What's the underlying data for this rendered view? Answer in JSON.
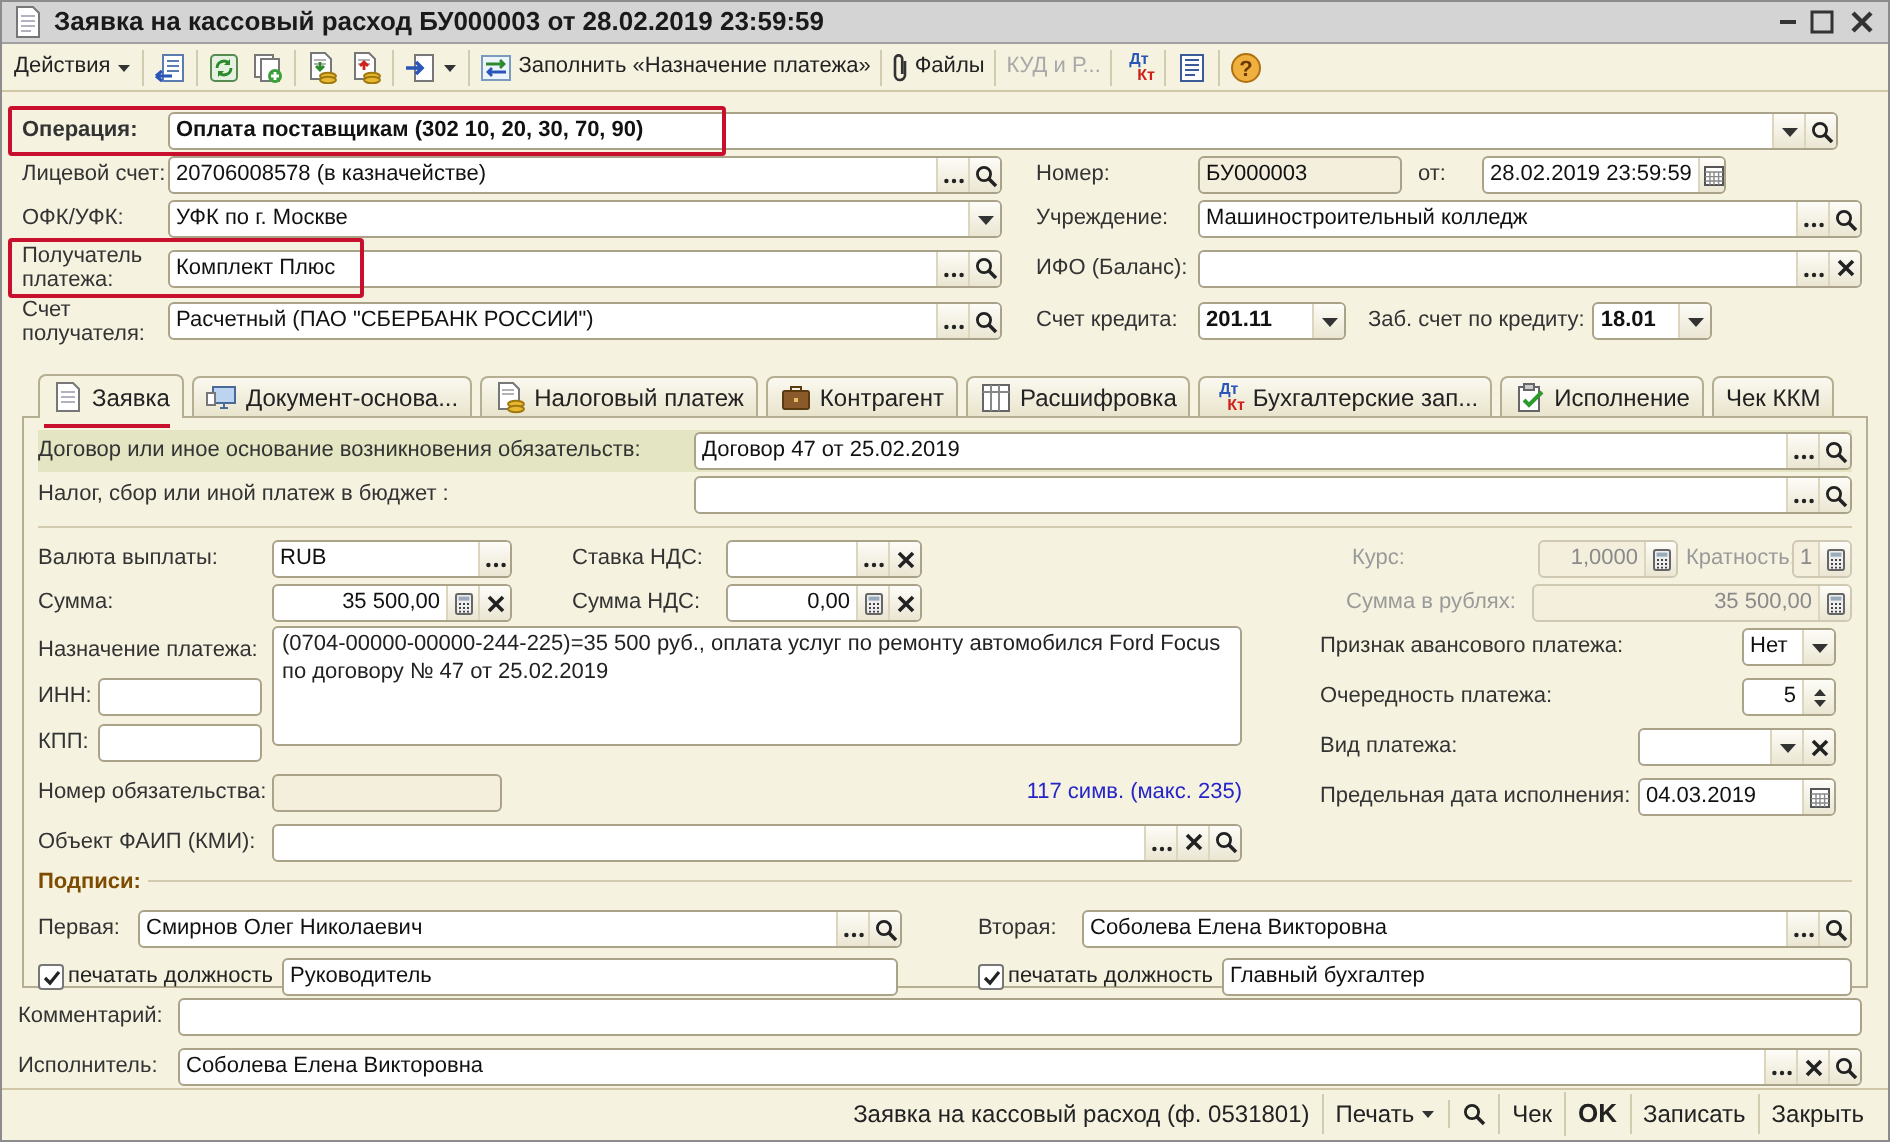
{
  "window": {
    "title": "Заявка на кассовый расход БУ000003 от 28.02.2019 23:59:59"
  },
  "toolbar": [
    {
      "kind": "menu",
      "label": "Действия",
      "disabled": false
    },
    {
      "kind": "separator"
    },
    {
      "kind": "icon",
      "disabled": false
    },
    {
      "kind": "separator"
    },
    {
      "kind": "icon",
      "disabled": false
    },
    {
      "kind": "icon",
      "disabled": false
    },
    {
      "kind": "separator"
    },
    {
      "kind": "icon",
      "disabled": false
    },
    {
      "kind": "icon",
      "disabled": false
    },
    {
      "kind": "separator"
    },
    {
      "kind": "icon_menu",
      "disabled": false
    },
    {
      "kind": "separator"
    },
    {
      "kind": "icon_text",
      "label": "Заполнить «Назначение платежа»",
      "disabled": false
    },
    {
      "kind": "separator"
    },
    {
      "kind": "icon_text",
      "label": "Файлы",
      "disabled": false
    },
    {
      "kind": "separator"
    },
    {
      "kind": "text",
      "label": "КУД и Р...",
      "disabled": true
    },
    {
      "kind": "separator"
    },
    {
      "kind": "debit_credit",
      "debit": "Дт",
      "credit": "Кт",
      "disabled": false
    },
    {
      "kind": "separator"
    },
    {
      "kind": "icon",
      "disabled": false
    },
    {
      "kind": "separator"
    },
    {
      "kind": "help",
      "label": "?",
      "disabled": false
    }
  ],
  "header": {
    "operation": {
      "label": "Операция:",
      "value": "Оплата поставщикам (302 10, 20, 30, 70, 90)",
      "highlighted": true
    },
    "account": {
      "label": "Лицевой счет:",
      "value": "20706008578 (в казначействе)"
    },
    "number": {
      "label": "Номер:",
      "value": "БУ000003",
      "readonly": true
    },
    "date": {
      "label": "от:",
      "value": "28.02.2019 23:59:59"
    },
    "ofk": {
      "label": "ОФК/УФК:",
      "value": "УФК по г. Москве"
    },
    "institution": {
      "label": "Учреждение:",
      "value": "Машиностроительный колледж"
    },
    "recipient": {
      "label": "Получатель платежа:",
      "value": "Комплект Плюс",
      "highlighted": true
    },
    "ifo": {
      "label": "ИФО (Баланс):"
    },
    "recipient_account": {
      "label": "Счет получателя:",
      "value": "Расчетный (ПАО \"СБЕРБАНК РОССИИ\")"
    },
    "credit_account": {
      "label": "Счет кредита:",
      "value": "201.11"
    },
    "off_balance": {
      "label": "Заб. счет по кредиту:",
      "value": "18.01"
    }
  },
  "tabs": [
    {
      "label": "Заявка",
      "selected": true,
      "highlighted": true
    },
    {
      "label": "Документ-основа...",
      "selected": false,
      "highlighted": false
    },
    {
      "label": "Налоговый платеж",
      "selected": false,
      "highlighted": false
    },
    {
      "label": "Контрагент",
      "selected": false,
      "highlighted": false
    },
    {
      "label": "Расшифровка",
      "selected": false,
      "highlighted": false
    },
    {
      "label": "Бухгалтерские зап...",
      "selected": false,
      "highlighted": false,
      "debit": "Дт",
      "credit": "Кт"
    },
    {
      "label": "Исполнение",
      "selected": false,
      "highlighted": false
    },
    {
      "label": "Чек ККМ",
      "selected": false,
      "highlighted": false
    }
  ],
  "request": {
    "basis": {
      "label": "Договор или иное основание возникновения обязательств:",
      "value": "Договор 47 от 25.02.2019",
      "focused": true
    },
    "tax": {
      "label": "Налог, сбор или иной платеж в бюджет :"
    },
    "currency": {
      "label": "Валюта выплаты:",
      "value": "RUB"
    },
    "vat_rate": {
      "label": "Ставка НДС:"
    },
    "rate": {
      "label": "Курс:",
      "value": "1,0000",
      "disabled": true
    },
    "multiplicity": {
      "label": "Кратность:",
      "value": "1",
      "disabled": true
    },
    "amount": {
      "label": "Сумма:",
      "value": "35 500,00"
    },
    "vat_amount": {
      "label": "Сумма НДС:",
      "value": "0,00"
    },
    "amount_rub": {
      "label": "Сумма в рублях:",
      "value": "35 500,00",
      "disabled": true
    },
    "purpose": {
      "label": "Назначение платежа:",
      "value": "(0704-00000-00000-244-225)=35 500 руб., оплата услуг по ремонту автомобился Ford Focus\nпо договору № 47 от 25.02.2019"
    },
    "inn": {
      "label": "ИНН:"
    },
    "kpp": {
      "label": "КПП:"
    },
    "obligation_number": {
      "label": "Номер обязательства:",
      "readonly": true
    },
    "char_count": "117 симв. (макс. 235)",
    "faip": {
      "label": "Объект ФАИП (КМИ):"
    },
    "advance": {
      "label": "Признак авансового платежа:",
      "value": "Нет"
    },
    "priority": {
      "label": "Очередность платежа:",
      "value": "5"
    },
    "payment_type": {
      "label": "Вид платежа:"
    },
    "deadline": {
      "label": "Предельная дата исполнения:",
      "value": "04.03.2019"
    },
    "signatures": {
      "title": "Подписи:",
      "first": {
        "label": "Первая:",
        "value": "Смирнов Олег Николаевич"
      },
      "first_print": {
        "label": "печатать должность",
        "checked": true
      },
      "first_position": {
        "value": "Руководитель"
      },
      "second": {
        "label": "Вторая:",
        "value": "Соболева Елена Викторовна"
      },
      "second_print": {
        "label": "печатать должность",
        "checked": true
      },
      "second_position": {
        "value": "Главный бухгалтер"
      }
    }
  },
  "comment": {
    "label": "Комментарий:"
  },
  "executor": {
    "label": "Исполнитель:",
    "value": "Соболева Елена Викторовна"
  },
  "footer": [
    {
      "kind": "text",
      "label": "Заявка на кассовый расход (ф. 0531801)"
    },
    {
      "kind": "menu",
      "label": "Печать"
    },
    {
      "kind": "search"
    },
    {
      "kind": "text",
      "label": "Чек"
    },
    {
      "kind": "default",
      "label": "OK"
    },
    {
      "kind": "text",
      "label": "Записать"
    },
    {
      "kind": "text",
      "label": "Закрыть"
    }
  ]
}
